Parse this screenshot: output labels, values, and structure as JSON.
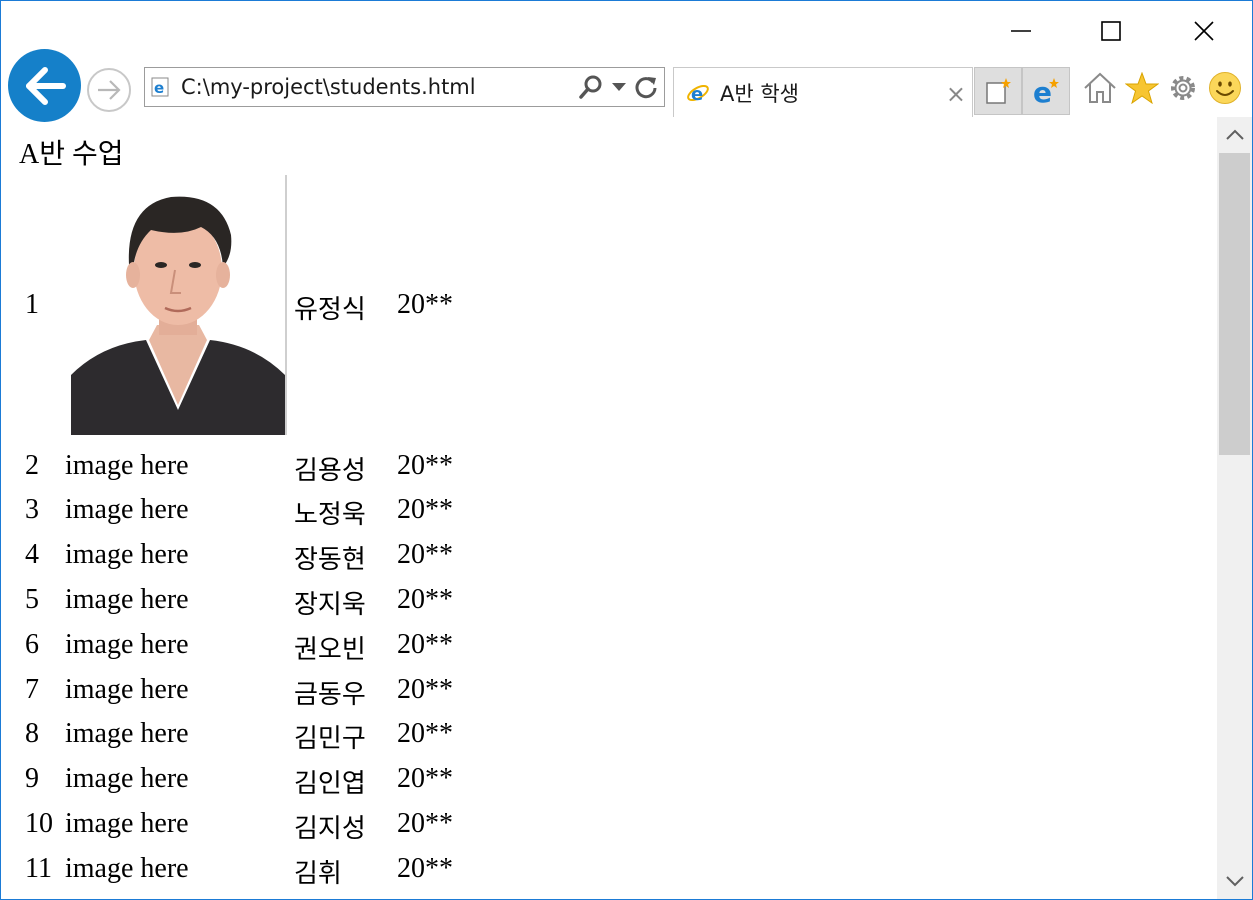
{
  "window": {
    "minimize_icon": "minimize-icon",
    "maximize_icon": "maximize-icon",
    "close_icon": "close-icon"
  },
  "nav": {
    "back_icon": "back-arrow-icon",
    "forward_icon": "forward-arrow-icon",
    "address": "C:\\my-project\\students.html",
    "search_icon": "search-icon",
    "dropdown_icon": "chevron-down-icon",
    "refresh_icon": "refresh-icon"
  },
  "tab": {
    "title": "A반 학생",
    "close_label": "×"
  },
  "toolbar": {
    "icons": [
      "new-tab-icon",
      "edge-icon",
      "home-icon",
      "favorites-star-icon",
      "settings-gear-icon",
      "smiley-feedback-icon"
    ]
  },
  "page": {
    "heading": "A반 수업",
    "students": [
      {
        "num": "1",
        "image": "",
        "name": "유정식",
        "year": "20**"
      },
      {
        "num": "2",
        "image": "image here",
        "name": "김용성",
        "year": "20**"
      },
      {
        "num": "3",
        "image": "image here",
        "name": "노정욱",
        "year": "20**"
      },
      {
        "num": "4",
        "image": "image here",
        "name": "장동현",
        "year": "20**"
      },
      {
        "num": "5",
        "image": "image here",
        "name": "장지욱",
        "year": "20**"
      },
      {
        "num": "6",
        "image": "image here",
        "name": "권오빈",
        "year": "20**"
      },
      {
        "num": "7",
        "image": "image here",
        "name": "금동우",
        "year": "20**"
      },
      {
        "num": "8",
        "image": "image here",
        "name": "김민구",
        "year": "20**"
      },
      {
        "num": "9",
        "image": "image here",
        "name": "김인엽",
        "year": "20**"
      },
      {
        "num": "10",
        "image": "image here",
        "name": "김지성",
        "year": "20**"
      },
      {
        "num": "11",
        "image": "image here",
        "name": "김휘",
        "year": "20**"
      }
    ]
  },
  "colors": {
    "accent": "#1580c9",
    "window_border": "#1b7bd6",
    "scrollbar_track": "#f0f0f0",
    "scrollbar_thumb": "#cdcdcd"
  }
}
